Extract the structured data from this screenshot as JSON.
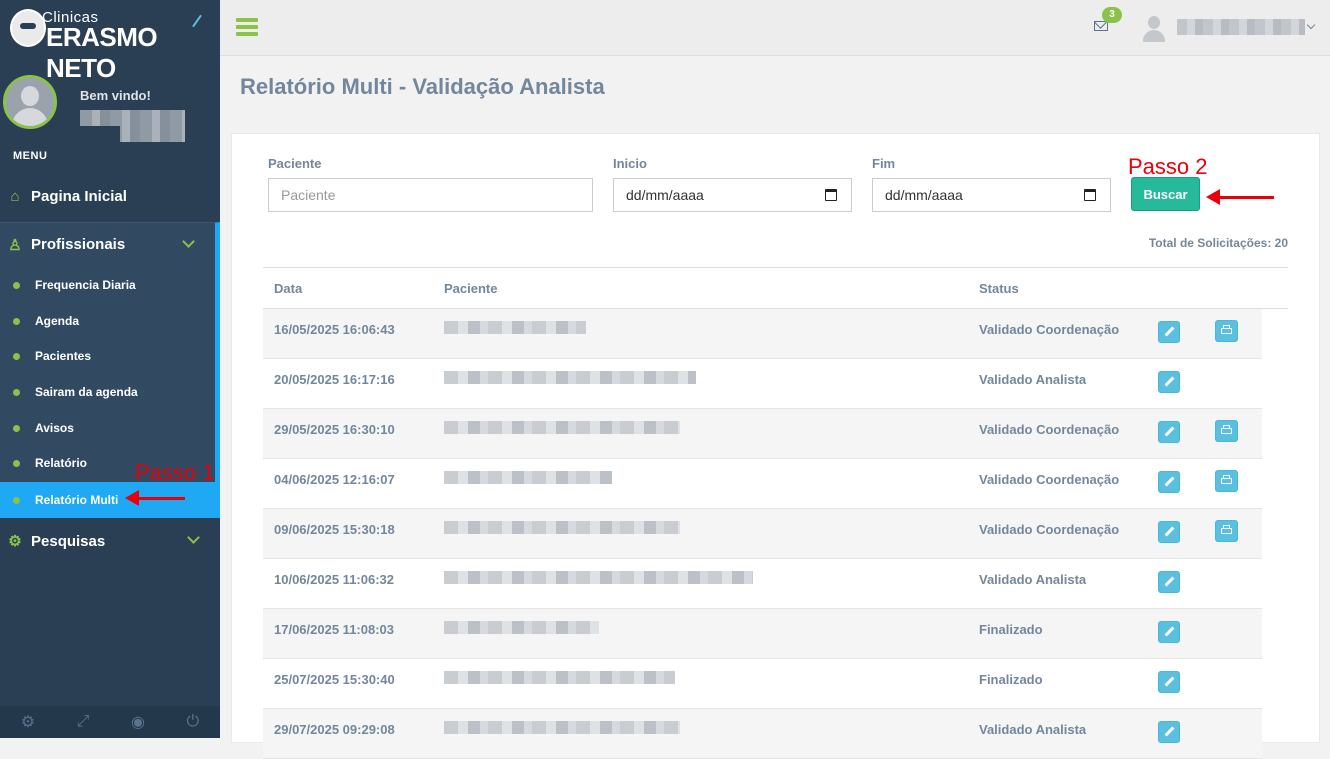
{
  "brand": {
    "small": "Clinicas",
    "big": "ERASMO NETO"
  },
  "sidebar": {
    "welcome": "Bem vindo!",
    "menu_title": "MENU",
    "items": [
      {
        "label": "Pagina Inicial",
        "icon": "home-icon"
      },
      {
        "label": "Profissionais",
        "icon": "users-icon"
      },
      {
        "label": "Pesquisas",
        "icon": "cogs-icon"
      }
    ],
    "submenu": [
      {
        "label": "Frequencia Diaria"
      },
      {
        "label": "Agenda"
      },
      {
        "label": "Pacientes"
      },
      {
        "label": "Sairam da agenda"
      },
      {
        "label": "Avisos"
      },
      {
        "label": "Relatório"
      },
      {
        "label": "Relatório Multi",
        "active": true
      }
    ],
    "footer_icons": [
      "settings-icon",
      "fullscreen-icon",
      "eye-slash-icon",
      "power-icon"
    ]
  },
  "topbar": {
    "mail_count": "3"
  },
  "page": {
    "title": "Relatório Multi - Validação Analista"
  },
  "filters": {
    "paciente_label": "Paciente",
    "paciente_placeholder": "Paciente",
    "inicio_label": "Inicio",
    "inicio_value": "dd/mm/aaaa",
    "fim_label": "Fim",
    "fim_value": "dd/mm/aaaa",
    "buscar_label": "Buscar"
  },
  "total_label": "Total de Solicitações: 20",
  "annotations": {
    "step1": "Passo 1",
    "step2": "Passo 2"
  },
  "table": {
    "headers": [
      "Data",
      "Paciente",
      "Status"
    ],
    "rows": [
      {
        "date": "16/05/2025 16:06:43",
        "status": "Validado Coordenação",
        "print": true
      },
      {
        "date": "20/05/2025 16:17:16",
        "status": "Validado Analista",
        "print": false
      },
      {
        "date": "29/05/2025 16:30:10",
        "status": "Validado Coordenação",
        "print": true
      },
      {
        "date": "04/06/2025 12:16:07",
        "status": "Validado Coordenação",
        "print": true
      },
      {
        "date": "09/06/2025 15:30:18",
        "status": "Validado Coordenação",
        "print": true
      },
      {
        "date": "10/06/2025 11:06:32",
        "status": "Validado Analista",
        "print": false
      },
      {
        "date": "17/06/2025 11:08:03",
        "status": "Finalizado",
        "print": false
      },
      {
        "date": "25/07/2025 15:30:40",
        "status": "Finalizado",
        "print": false
      },
      {
        "date": "29/07/2025 09:29:08",
        "status": "Validado Analista",
        "print": false
      }
    ]
  },
  "colors": {
    "sidebar": "#2a3f54",
    "accent_green": "#8bc34a",
    "active_blue": "#1fa9f5",
    "button": "#26b99a",
    "annotation": "#e8000b"
  }
}
